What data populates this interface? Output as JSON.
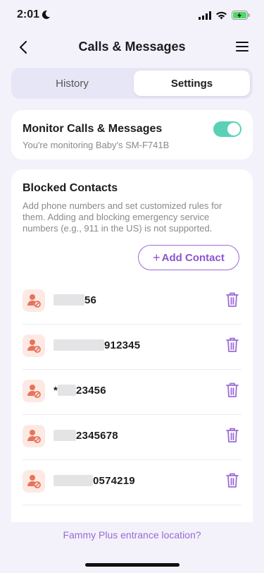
{
  "status_bar": {
    "time": "2:01"
  },
  "nav": {
    "title": "Calls & Messages"
  },
  "tabs": [
    {
      "label": "History",
      "selected": false
    },
    {
      "label": "Settings",
      "selected": true
    }
  ],
  "monitor": {
    "title": "Monitor Calls & Messages",
    "subtitle": "You're monitoring Baby's SM-F741B",
    "enabled": true
  },
  "blocked": {
    "title": "Blocked Contacts",
    "description": "Add phone numbers and set customized rules for them. Adding and blocking emergency service numbers (e.g., 911 in the US) is not supported.",
    "add_label": "Add Contact",
    "contacts": [
      {
        "prefix": "",
        "suffix": "56"
      },
      {
        "prefix": "",
        "suffix": "912345"
      },
      {
        "prefix": "*",
        "suffix": "23456"
      },
      {
        "prefix": "",
        "suffix": "2345678"
      },
      {
        "prefix": "",
        "suffix": "0574219"
      }
    ]
  },
  "footer": {
    "link": "Fammy Plus entrance location?"
  },
  "colors": {
    "accent": "#9b6bd6",
    "toggle": "#5ad1b5",
    "avatar_bg": "#fde9e4",
    "avatar_icon": "#e8735a"
  },
  "icons": [
    "moon-icon",
    "signal-icon",
    "wifi-icon",
    "battery-icon",
    "back-chevron-icon",
    "menu-icon",
    "plus-icon",
    "blocked-user-icon",
    "trash-icon"
  ]
}
